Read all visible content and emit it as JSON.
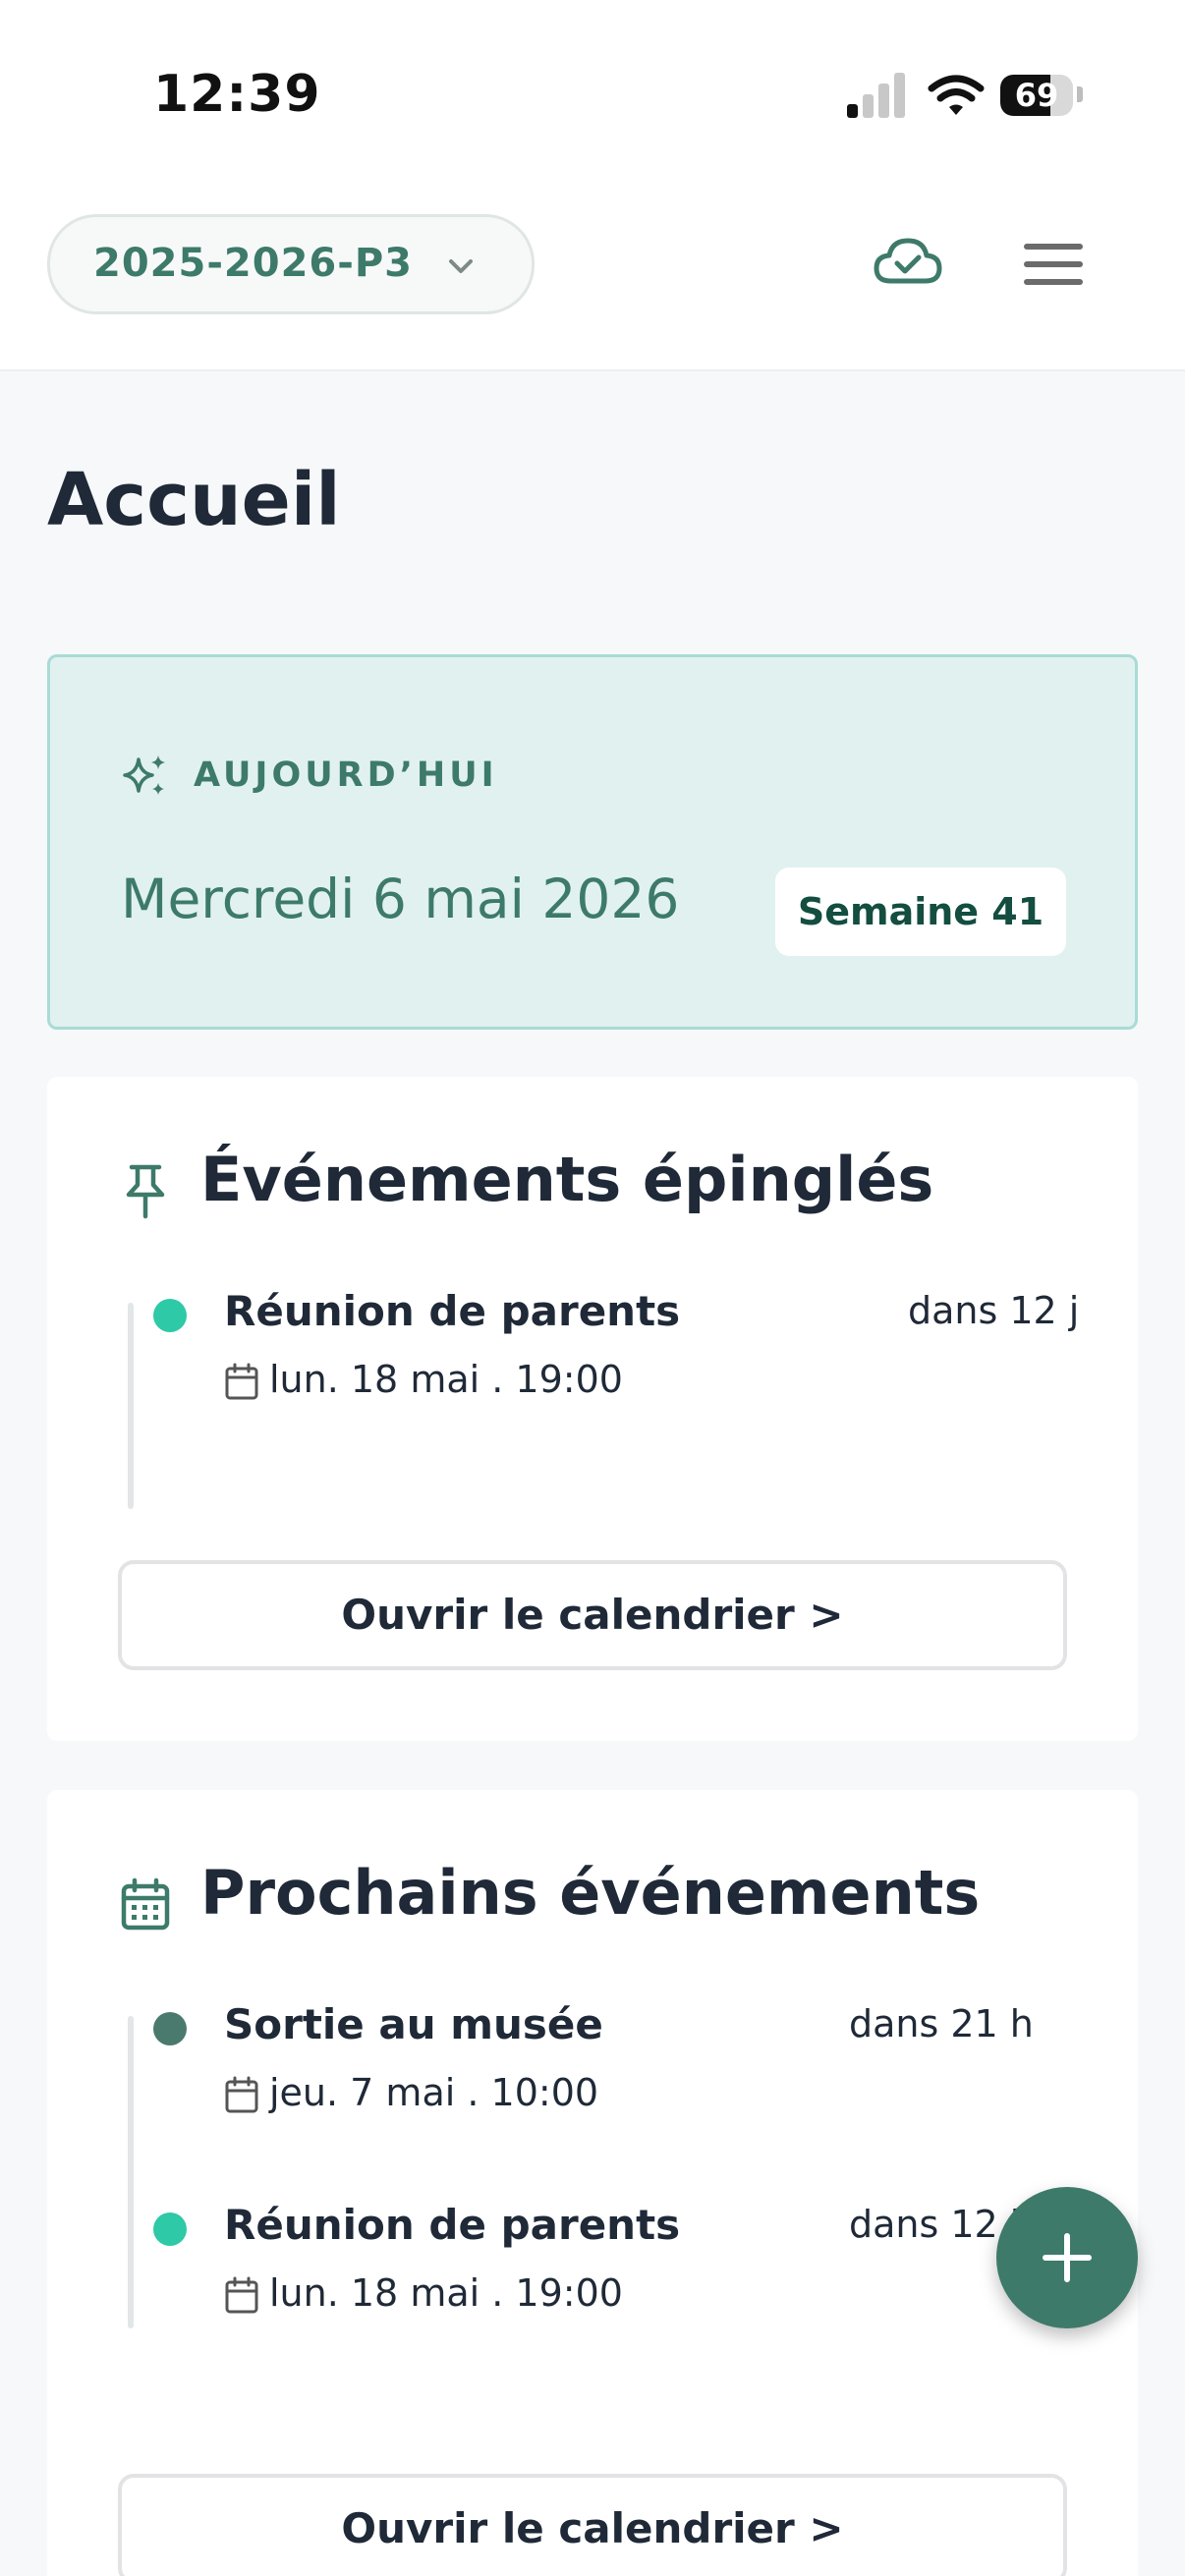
{
  "status_bar": {
    "time": "12:39",
    "battery": "69",
    "battery_level": 0.69
  },
  "header": {
    "year_selector": "2025-2026-P3",
    "icons": [
      "chevron-down-icon",
      "cloud-check-icon",
      "hamburger-menu-icon"
    ]
  },
  "page": {
    "title": "Accueil"
  },
  "today": {
    "label": "AUJOURD’HUI",
    "date": "Mercredi 6 mai 2026",
    "week": "Semaine 41",
    "icon": "sparkles-icon"
  },
  "pinned": {
    "title": "Événements épinglés",
    "icon": "pin-icon",
    "events": [
      {
        "title": "Réunion de parents",
        "date": "lun. 18 mai . 19:00",
        "relative": "dans 12 j",
        "dot_color": "#2ec9a6"
      }
    ],
    "button": "Ouvrir le calendrier >"
  },
  "upcoming": {
    "title": "Prochains événements",
    "icon": "calendar-grid-icon",
    "events": [
      {
        "title": "Sortie au musée",
        "date": "jeu. 7 mai . 10:00",
        "relative": "dans 21 h",
        "dot_color": "#4a7a6d"
      },
      {
        "title": "Réunion de parents",
        "date": "lun. 18 mai . 19:00",
        "relative": "dans 12 j",
        "dot_color": "#2ec9a6"
      }
    ],
    "button": "Ouvrir le calendrier >"
  },
  "fab": {
    "icon": "plus-icon"
  },
  "colors": {
    "accent": "#3d7a6a",
    "today_bg": "#e1f1f0",
    "today_border": "#a9dbd5",
    "page_bg": "#f6f8f9"
  }
}
